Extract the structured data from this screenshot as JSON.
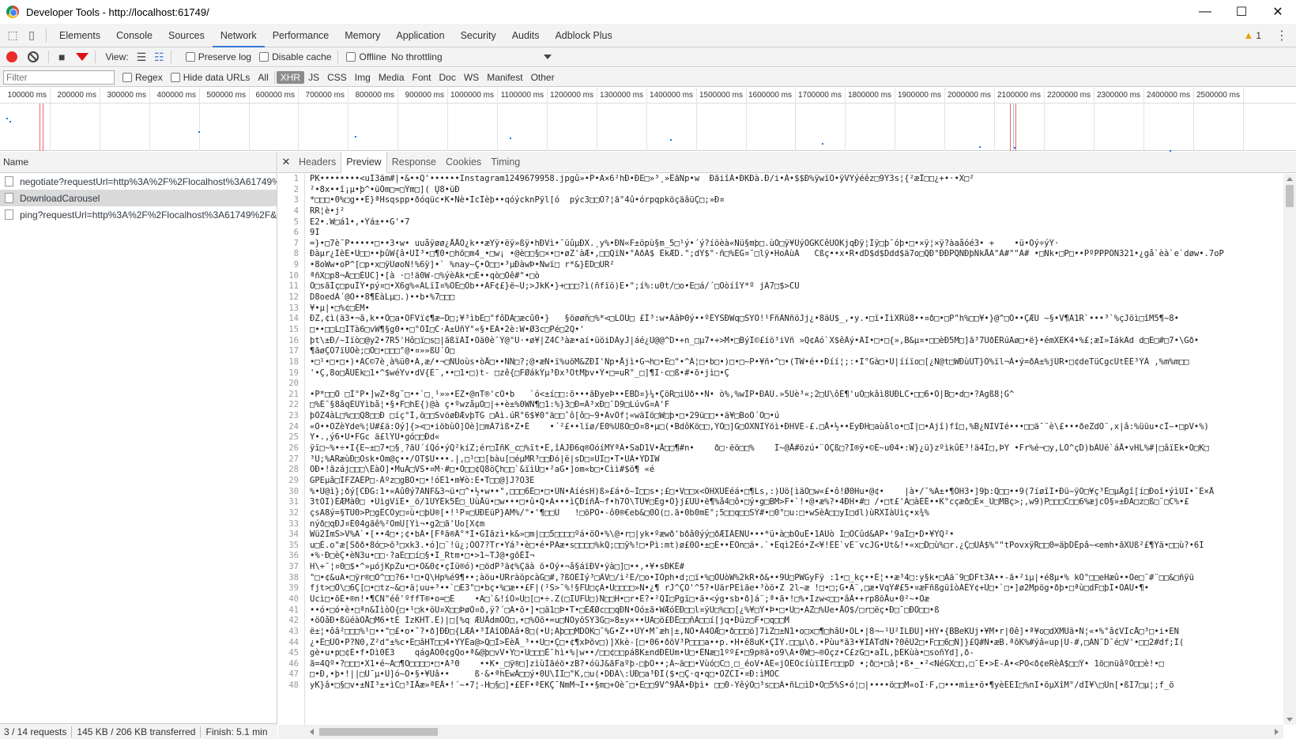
{
  "window": {
    "title": "Developer Tools - http://localhost:61749/",
    "minimize": "—",
    "maximize": "☐",
    "close": "✕"
  },
  "panels": [
    "Elements",
    "Console",
    "Sources",
    "Network",
    "Performance",
    "Memory",
    "Application",
    "Security",
    "Audits",
    "Adblock Plus"
  ],
  "warnings_count": "1",
  "toolbar": {
    "view_label": "View:",
    "preserve_log": "Preserve log",
    "disable_cache": "Disable cache",
    "offline": "Offline",
    "throttling": "No throttling"
  },
  "filter": {
    "placeholder": "Filter",
    "regex": "Regex",
    "hide_data_urls": "Hide data URLs",
    "types": [
      "All",
      "XHR",
      "JS",
      "CSS",
      "Img",
      "Media",
      "Font",
      "Doc",
      "WS",
      "Manifest",
      "Other"
    ],
    "active_type": "XHR"
  },
  "timeline_ticks": [
    "100000 ms",
    "200000 ms",
    "300000 ms",
    "400000 ms",
    "500000 ms",
    "600000 ms",
    "700000 ms",
    "800000 ms",
    "900000 ms",
    "1000000 ms",
    "1100000 ms",
    "1200000 ms",
    "1300000 ms",
    "1400000 ms",
    "1500000 ms",
    "1600000 ms",
    "1700000 ms",
    "1800000 ms",
    "1900000 ms",
    "2000000 ms",
    "2100000 ms",
    "2200000 ms",
    "2300000 ms",
    "2400000 ms",
    "2500000 ms"
  ],
  "requests": {
    "header": "Name",
    "items": [
      "negotiate?requestUrl=http%3A%2F%2Flocalhost%3A61749%2F",
      "DownloadCarousel",
      "ping?requestUrl=http%3A%2F%2Flocalhost%3A61749%2F&..."
    ],
    "selected_index": 1
  },
  "status": {
    "requests": "3 / 14 requests",
    "transferred": "145 KB / 206 KB transferred",
    "finish": "Finish: 5.1 min"
  },
  "detail_tabs": [
    "Headers",
    "Preview",
    "Response",
    "Cookies",
    "Timing"
  ],
  "active_detail_tab": "Preview",
  "preview_lines": [
    "PK••••••••<uÍ3äm#|•&••Q'••••••Instagram1249679958.jpgû»•P•A×6²hÐ•ÐE□»³¸»ÊãNp•w  ÐãiîÁ•ÐKÐà.Ð/i•Á•$$Ð%ÿwïÕ•ÿVÝýéêz□9Ý3s¦{²æÎ□□¿+•·•X□²",
    "²•8x••î¡µ•þ^•üÖm□=□Ým□]( ̧Ù8•üÐ",
    "*□□□•0%□g••È}ªHsqspp•ðóqüc•K•Nè•ÌcÎèþ••qóýcknPÿl[ó  pýc3□□Õ?¦ã°4û•órpqpköçäâüÇ□;»Ð¤",
    "RR¦è•j²",
    "Ë2•.W□á1•,•Ýá±••G'•7",
    "9I",
    "=}•□7è¯P•••••□••3•w• uuåÿøø¿ÅÅÖ¿k••æYÿ•ëÿ»ßÿ•hÐVì•¯üûµÐX.¸y%•ÐÑ«F±öpù§m_5□¹ý•´ý?íöèà«Nü§mþ□.ùÖ□ÿ¥ÛýÕGKCêUOKjqÐÿ¦Íÿ□þ¯óþ•□•×ÿ¦×ÿ?àaåóé3• +    •ü•Óý÷ýÝ·",
    "Ðàµr¿ÌèË•Û□□••þûW{â•ÛÌ³•□¶0•□hõ□m4_•□w¡ •@è□□§□×•□•øZ'àÆ•,□□QïÑ•°ÃðÃ$ ÊkÆD.\";dY$°·ñ□%ËG¤¯□lÿ•HoÄùÀ   Cßç••x•R•dD$d$Ddd$ä7o□QÐ°ÐÐPQÑÐþÑkÅÃ\"Ä#\"\"Ä# •□Ñk•□P□••PºPPPÓÑ321•¿gå`èà`e`døw•.7oP",
    "•8oWw•oP^[□p•x□ÿÜøoÑ!%6ÿ]•` %nay~Ç•Ö□□•³µÐàwÞ•Ñwï□ r*&}ÉD□ÜR²",
    "ªñX□p8¬Â□□ÈÙC]•[à ·□!ä0W-□%ýèÄk•□Ë••qò□Öê#\"•□ò",
    "Ô□sãÌç□puÎÝ•pý¤□•X6g%«ÄLïÏ¤%ÓE□Öb••ÄF¢£}ë~Ü;>JkK•}+□□□?ì(ñfïö)E•\";í%:u0t/□o•E□á/´□ÖòíîY*º jÄ7□$>CÚ",
    "D8oedÀ´@Ö••8¶ÈàLµ□.)••b•%7□□□",
    "¥•µ|•□%¢□EM•",
    "ÐZ,¢ì(ä3•¬ã,k••Ô□a•OFVï¢¶æ−D□;¥³ìbË□\"fôDÄ□æcû0•}   §öøøñ□%*<□LÖÛ□ £Í³:w•ÁâÞ0ý••ºÉYSÐWq□SYÖ!¹FñÂÑñöJj¿•8äÚ$_,•y.•□ï•ÏìXRü8••¤ð□•□P\"h%□□¥•}@^□Ö••ÇÆÚ ~§•V¶À1R`•••³`%çJöì□îM5¶~8•",
    "□••□□L□ÌTà6□vW¶§g0••□°ÓÍ□C·Á±ÛñY°«§•ÉÂ•2è:W•Ø3c□Pé□2Q•'",
    "þt\\±Ð/~Iïò□@y2•7R5'Hô□ï□s□|ãßïÁÎ•Óä0è¯Ý@°U·•ø¥|Z4C³àæ•aí•üöiDÀyJ|áé¿Ù@@^D•+n_□µ7•+>M•□BýÏ©£íö³iVñ »Q¢Äó`X$êÂý•ÃI•□•□{»,B&µ¤•□□èÐ5M□]ã³7UðÊRúÄø□•ë}•émXEK4•%£;æI»IákÄd d□E□#□7•\\Gð•",
    "¶ãøÇÓ7ïÚÖè;□Ö□•□□□°@•¤»»ßÜ´Ô□",
    "•□¹•□•□•)•ÄC©7è¸à%ü0•A,æ/•¬□ÑÙoùs•òÅ□••ÑÑ□?;@•æÑ•ï%uöM&ZÐI'Np•Åjì•G¬h□•É□\"•^Á¦□•b□•)□•□~P•¥ñ•^□•(TW•é••Ðíí¦;:•Ï°Gà□•Ù|ííïo□[¿N@t□WÐùÜT}Ò%ïl¬À•ý=ðA±%jÚR•□¢deTüCgcUtÉÉ³ÝÂ ,%m%m□□",
    "'•Ç,8o□ÅÙÈk□1•^$wéYv•dV{È¯,••□1•□)t- □zê{□FØákÝµ³Ðx³ÕtMþv•Ý•□=uR°_□]¶I·c□ß•#•õ•jì□•Ç",
    "",
    "•P*□□Ò □Í°P•]wZ•8g¯□••`□¸¹»»•ËZ•@nT®'cÖ•b   `ó<±í□□:õ•••ãÐyeÞ••ÈBD¤}¼•ÇöR□iÙð••N• ò%,%wÌP•ÐÁÚ.»5Ùè³«;2□Ü\\ôÈ¶'uÓ□kâì8ÙÐLC•□□6•Ö|B□•d□•?Ãgß8¦G^",
    "□%É¯§8âqÉÚÝìbå¦•§•F□hE{)@à ç•ºwzåµÖ□|+•è±%0WÑ¶□1:%}3□Ð=Â³xÐ□¯D9□LúvG¤A'F",
    "þÖZ4àL□%□□Q8□□Ð □íç°Î,ö□□SvöøÐÆvþTG □Äì.úR°6$¥0°ä□□ˆô[ô□~9•ÄvÖf¦«wäÏö□W□þ•□•29ü□□••ä¥□BoÖ´Ö□•ú",
    "«Ö••ÖZèYde%¦Ù#£ä:Öý]{><□•iöbùÖ]Öè]□mÂ7ìß•Z•É    •´²£••lïø/Ë0%ÛßÖ□Ö¤8•µ□(•BdôKö□□,ÝÖ□]G□OXÑÏÝöì•ÐHVÊ-£.□Å•½••ËyÐH□aùålo•□Î|□•Ajî)fî□,%B¿NIVÏé•••□□ä¯¨è\\£•••ðeZdÖ¨,x|â:%üüu•cÎ~•□pV•%)",
    "Y•.,ý6•U•FGc ä£lÝÜ•gó□□Ðd«",
    "ÿï□~%•÷•I{E~±□7•□§¸?ãÚ´íQó•ýQ²kíZ;ér□ÎñK_c□%ït•É,îÀJÐ6q®ÔóíMÝªÂ•SaD1V•Å□□¶#n•    ð□·ëö□□%    Ì~@Å#özú•¨ÔÇß□?Ì®ÿ•©È~u04•:W}¿ü}zºìkûÉ³!ä4Î□,ÞY •Fr%é¬□y,LÓ^çD)bÂÛë`áÅ•vHL%#|□âïËk•Ò□K□",
    "³Ú;%ÄRæùÐ□Osk•Öm@ç••/ÖT$Ü•••.|,□¹□□[bàu[□éµMR³□□Ðó|ë|sD□¤ÜI□•T•ÙÂ•ÝDIW",
    "ÖÐ•!ãzáj□□□\\ÊàÖ]•MuÂ□VS•¤M·#□•Ö□□¢Q8öÇh□□`&ïìÛ□•²aG•]om«b□•Cìì#$ö¶ «é",
    "GPEµâ□IFZÃÊP□-Âºz□gBÔ•□•!óÉ1•m¥ò:Ë•T□□@]J?Ö3É",
    "%•Ü@ì};ðý[CÐG:1•«Ãû0ý7ÃÑF&3¬ü•□^•½•w••\",□□□6Ê□•□•ÜÑ•ÀíésH)ß»£á•õ~Ì□□s•;£□•V□□x<ÖHXÛÉéá•□¶Ls,:)Ûö[ìäÓ□w«£•ô!Ø0Hu•@¢•    |à•/¯%Ã±•¶ÖH3•]9þ:Q□□••9(7íøîÏ•Ðü~ÿÕ□¥ç³Ê□µÅgî[í□Ðoî•ýìÙI•¯É×Å",
    "3tÖI)ÉÆMà0□ •ÜìgVïÉ•_ö/1ÚYÉk5É□_ÙùÅü•□w•••□•û•Q•Ã•••ìÇÐíñÅ~f•h7Ö\\TÛ¥□Ég•Ö}j£ÙÚ•ë¶%å4□ô•□ý•g□BM>F•`!•@•æ%?•4ÐH•#□ /•□t£'Ä□àÉÊ••K°cçæð□É×_Ü□MBç>;,w9)P□□□C□□6%æjcÖ§»±ÐA□z□ß□¨□C%•£",
    "çsÃ8ý=§TÚ0>P□gÊCÕy□¤ù•□þÙ®[•!¹P¤□ÜÐEüP}ÃM%/°•'¶□□Ú   !□öPÖ•-ô0®€eb&□0Ö(□.ã•0b0mE°;5□□q□□SÝ#•□0°□u:□•wSèÀ□□yI□dl)ùRXÏàUìç•x¾%",
    "nýð□qÐJ¤É04gãê%²OmÜ[Ýì¬•g2□ã'Uo[X¢m",
    "Wü2ÌmS>V%Ä`•[••4□•;¢•bÂ•[Fªã®Â°*Í•GÌãzì•k&»□m|□□5□□□□ºá•öÕ•%\\@•r□|yk•ºæwð'bðâ0ýý□ðÆIÂÈÑÜ•••*ü•à□bÔuÊ•1AÙò Ì□ÓCûd&AP•'9aÏ□•D•¥YQ²•",
    "u□È.o\"æ[Sðð•8ó□>õ³□xk3.•ó]□¨!ü¿;ÖÖ7?Tr•Yá³•è□•é•PÃæ•s□□□□%kQ;□□ÿ%!□•Pì:mt)ø£0Ö•±□È••ÊÕn□ä•.`•Ëqì2Êó•Z<¥!ÈÊ`vÈ¨vcJG•Út&!•«x□D□ù%□r.¿Ç□ÙÁ$%\"\"tPovxÿR□□0=äþDÊpâ~<emh•ãXÜß²£¶Ýä•□□ù?•6Ì",
    "•%·Ð□èÇ•èÑ3u•□□·?aÉ□□í□§•Ï_Rtm•□•>1~TJ@•gõÉÎ¬",
    "H\\+¯¦¤0□$•^»µójKpZu•□•Ö&0¢•çÌü®ó)•□ödP³ä¢%Çäà ö•Öý•¬å§áïÐV•ÿà□]□••,•¥•sÐKÉ#",
    "\"□•¢&uA•□ÿr®□Ö^□□?6•¹□•Q\\Hp%é9¶••;àöu•ÜRràöpcàG□#,?ßÕÉÍý³□ÂV□/ì²É/□o•ÏÖph•d;□ï•%□ÔUòW%2kR•ð&••9U□PWGyFÿ :1•□_kç••É¦••æ³4□:y§k•□Ää¨9□DFt3A••-ã•²iµ|•é8µ•% kÕ°□□eHæû••Öe□¨#¨□□&□ñÿü",
    "fjt>□Ö\\□6Ç[□•□tz~&□•ä¦uu+³••`□E3\"□•bç•%□æ••£F|(¹S>¯%!§FU□çÄ•Ü□□□□»N•¿¶ rJ^ÇÖ'^5?•ÜärPEìãe•³òö•Z 2l~æ !□•□;G•Ä¨,□æ•VqÝ#£5•¤æFñßgüîòÁÊÝ¢+Ù□•`□•]ø2Mpög•ðþ•□ªù□dF□þÏ•ÖÃU•¶•",
    "Ûcì□•õÈ•®n!•¶CÑ\"éê'ºffT®•o=□È    •Ä□`&!íÖ»Ü□[□•÷.Z(□ÌUFÙ□)Ñ□□H•□r•È?•²QI□Pgï□•ä•<ýg•sb•ð]á¨;ª•ã•!□%•Ìzw<□□•âÂ•+rp8öÅu•0²~•Öæ",
    "••ó•□ó•è•□ªn&ÎìòÕ{□•¹□k•öÙ¤X□□ÞøÒ¤ð,ÿ?´□Ä•õ•]•□ä1□Þ•T•□ÊÆØc□□qÐÑ•Òó±ã•WÆóÊÐ□□l¤ÿÙ□%□□[¿%¥□Ý•Þ•□•Ü□•ÃZ□%Üe•ÅÔ$/□r□ëç•Ð□¯□ÐÖ□□•ß",
    "•öÖåÐ•ßüéàÖÅ□M6•tË ÍzKHT.Ê)|□[%q ÆUÅdmÖÕ□,•□%Õõ•=u□ÑÖyõSY3G□»8±y×••ÜÃ□ö£ÐÊ□□ñÁ□□í[jq•Ðüz□F•□q□□M",
    "ë±¦•ôâ²□□□%¹□••\"□£•o•¯?•ð]ÐÐ□{LÆÁ•³ÌÁîÕÐAâ•8□(•Ü;Äþ□□MDÕK□¯%G•Z••ÜY•M¯æh|±,NÕ•Á4OÆ□•ð□□□ö]7ìZ□±N1•o□x□¶□hâÜ•OL•|8¬~¹Ü²ÌLÐU]•HÝ•{BBeKUj•¥M•r|0ê]•ª¥o□dXMÜä•Ñ¦«•%°â¢VIcÅ□³□•i•EN",
    "¿•Ê□ÜÖ•P?Ñ0,Z²d\"±%c•È□âHT□□4•ÝÝÈa@>Q□Ì>ÊèÅ_³••Ü□•Ç□•¢¶xÞõv□)]Xkè-[□•06•ðõV³P□□□a••p.•H•ê8uK•ÇÍÝ.□□µ\\ð.•Pùu*ã3•¥IÀTdÑ•?0êÜ2□•F□□6□Ñ]}£Q#N•æB.ªõK%#ýâ«up|Ü-#,□ÄN¯D¯é□V'•□□2#df;Ì(",
    "gè•u•p□¢É•f•Dì0È3    qágÁÖ0¢gQo•ª&@þ□vV•Y□•Ü□□□È¯hì•%|w••/□□¢□□pá8K±ndÐËÙm•Ü□•ÊÑæ□1ºº£•□9p®ã•o9\\Ä•0W□~®Öçz•C£zG□•aÎL,þÉKùà•□soñYd],ð-",
    "ã=4Qº•?□□□•X1•é~Ä□¶O□□□□•□•Ã³0    ••K•_□ÿ®□]zìùÌãéö•zB?•óüJ&ãFaºþ-□þÖ••;Á~ä□□•Vùó□C□¸□_éoV•ÄÊ«jÓÉÖcíùïÏÉr□□pD •;ð□•□â¦•ß•_•²<NéGX□□,□¯É•>É-Â•<PÖ<ð¢eRèÁ$□□Ý• 1ö□nüâºÖ□□è!•□",
    "□•Ð,•þ•!||□Ü¯µ•Ù]ó~Ö•§•¥Uâ••     ß·&•ªhÉwÂ□□ý•0U\\ÌÏ□\"K,□u(•DÐÂ\\:ÜÐ□a³ÐÌ($•□Ç·q•q□•ÖZCÏ•¤Ð:ìMÖC",
    "yK}â•□§□v•±ÑÏ³±•ìC□³ÏÅæ»ªEÅ•!´~•7¦-H□§□]•£ÉF•ªÉKÇ¯ÑmM¬Ï••§m□+Öè¯□•E□□9V^9ÅÅ•Ðþì• □□0-YêýÖ□³s□□À•ñL□ìD•Ö□5%S•ó¦□|••••ö□□M«oÏ·F,□•••mì±•ö•¶yèÉÉÏ□%nÏ•õµXîM°/dÍ¥\\□Ün[•ßI7□µ¦;f_ö"
  ]
}
